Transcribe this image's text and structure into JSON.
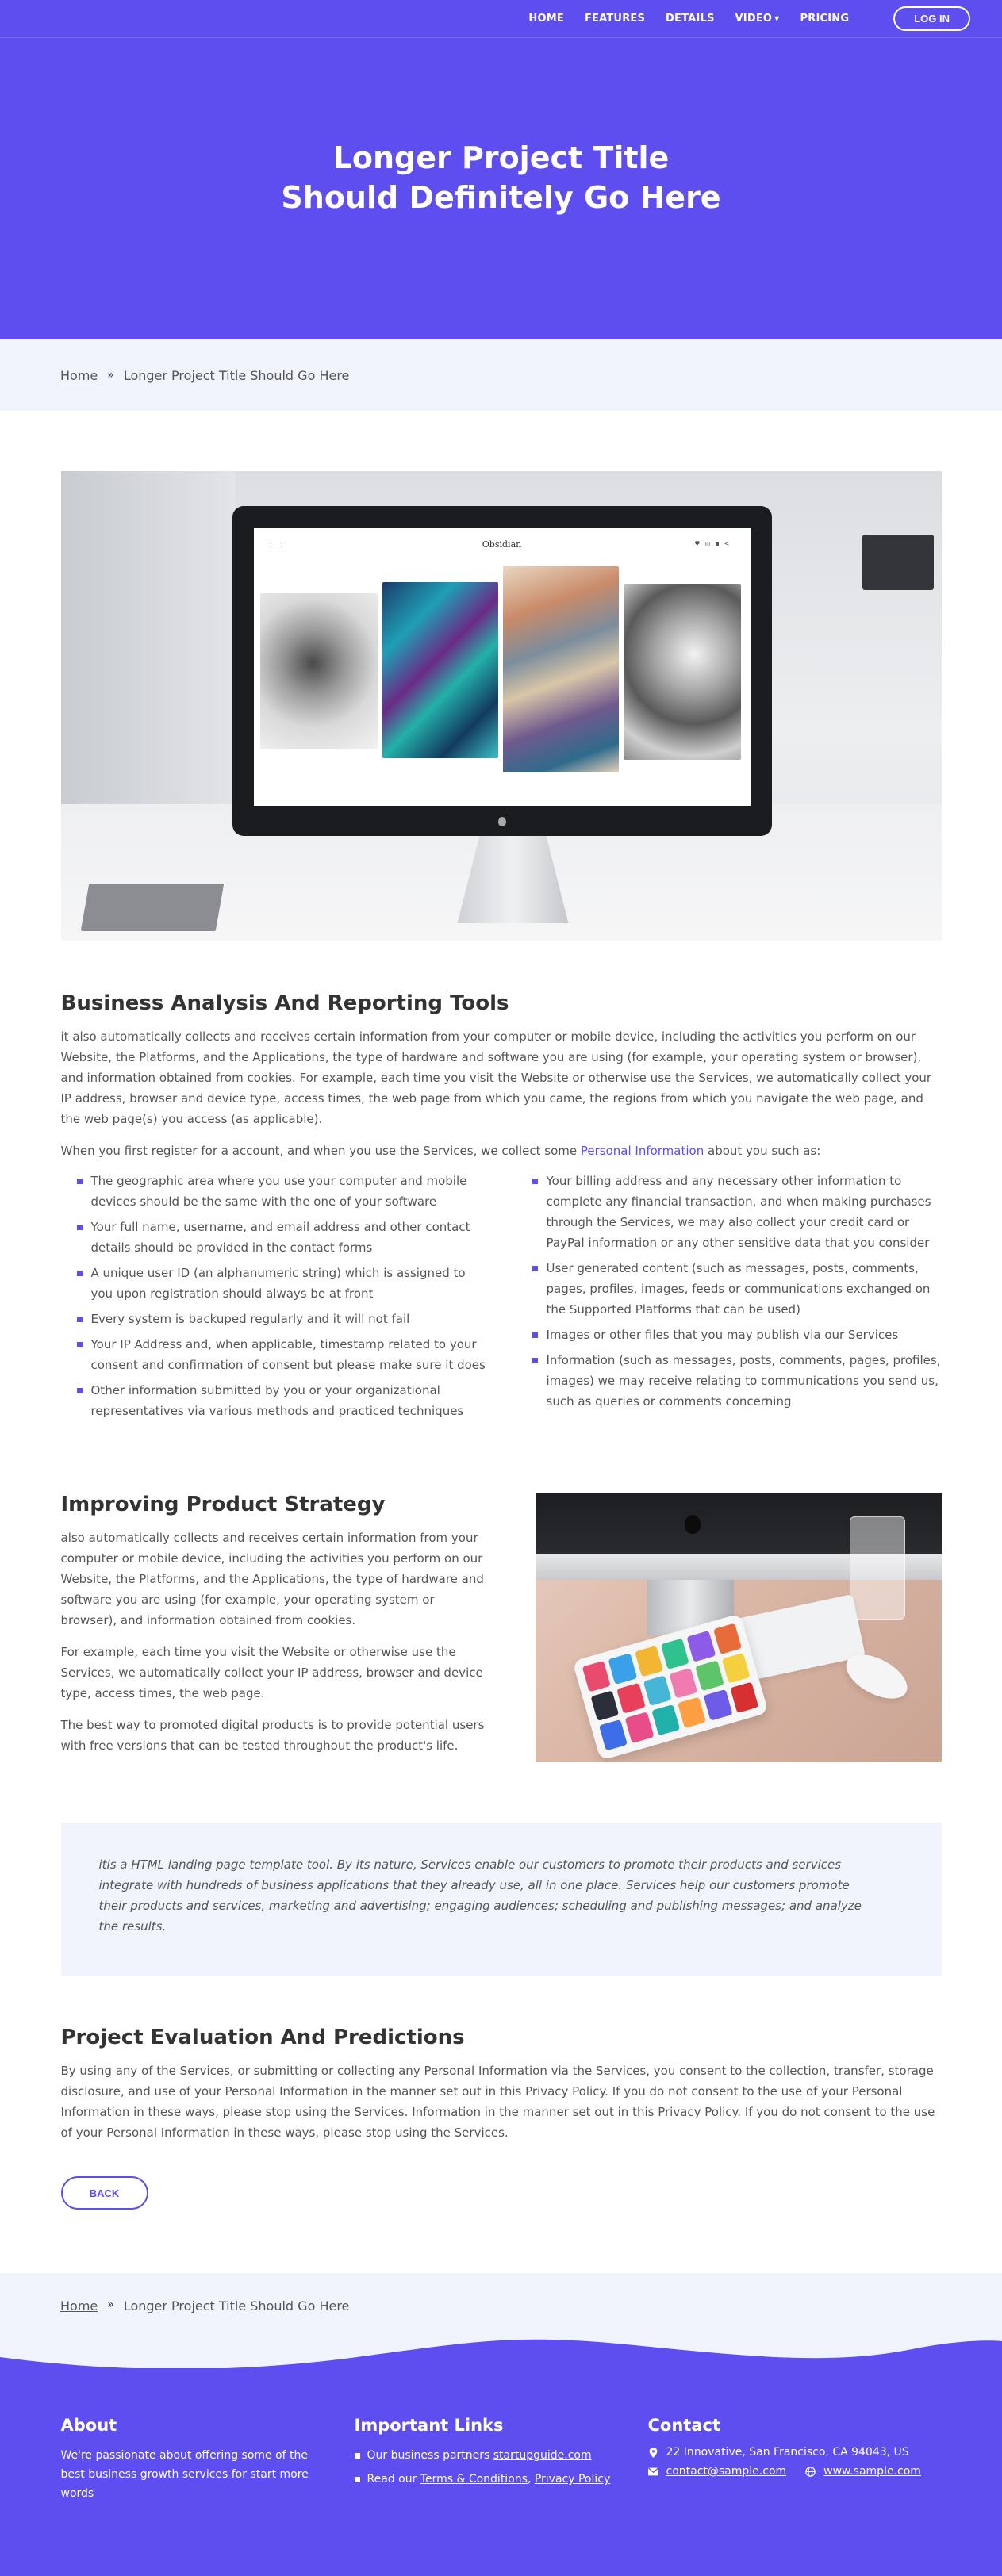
{
  "nav": {
    "links": [
      "HOME",
      "FEATURES",
      "DETAILS",
      "VIDEO",
      "PRICING"
    ],
    "login": "LOG IN"
  },
  "hero": {
    "title": "Longer Project Title Should Definitely Go Here"
  },
  "breadcrumb": {
    "home": "Home",
    "current": "Longer Project Title Should Go Here"
  },
  "main_image": {
    "screen_logo": "Obsidian",
    "icons": [
      "menu-icon",
      "twitter-icon",
      "instagram-icon",
      "linkedin-icon",
      "share-icon",
      "arrow-up-icon"
    ]
  },
  "section1": {
    "title": "Business Analysis And Reporting Tools",
    "p1": "it also automatically collects and receives certain information from your computer or mobile device, including the activities you perform on our Website, the Platforms, and the Applications, the type of hardware and software you are using (for example, your operating system or browser), and information obtained from cookies. For example, each time you visit the Website or otherwise use the Services, we automatically collect your IP address, browser and device type, access times, the web page from which you came, the regions from which you navigate the web page, and the web page(s) you access (as applicable).",
    "p2_before": "When you first register for a account, and when you use the Services, we collect some ",
    "p2_link": "Personal Information",
    "p2_after": " about you such as:",
    "list_left": [
      "The geographic area where you use your computer and mobile devices should be the same with the one of your software",
      "Your full name, username, and email address and other contact details should be provided in the contact forms",
      "A unique user ID (an alphanumeric string) which is assigned to you upon registration should always be at front",
      "Every system is backuped regularly and it will not fail",
      "Your IP Address and, when applicable, timestamp related to your consent and confirmation of consent but please make sure it does",
      "Other information submitted by you or your organizational representatives via various methods and practiced techniques"
    ],
    "list_right": [
      "Your billing address and any necessary other information to complete any financial transaction, and when making purchases through the Services, we may also collect your credit card or PayPal information or any other sensitive data that you consider",
      "User generated content (such as messages, posts, comments, pages, profiles, images, feeds or communications exchanged on the Supported Platforms that can be used)",
      "Images or other files that you may publish via our Services",
      "Information (such as messages, posts, comments, pages, profiles, images) we may receive relating to communications you send us, such as queries or comments concerning"
    ]
  },
  "section2": {
    "title": "Improving Product Strategy",
    "p1": "also automatically collects and receives certain information from your computer or mobile device, including the activities you perform on our Website, the Platforms, and the Applications, the type of hardware and software you are using (for example, your operating system or browser), and information obtained from cookies.",
    "p2": "For example, each time you visit the Website or otherwise use the Services, we automatically collect your IP address, browser and device type, access times, the web page.",
    "p3": "The best way to promoted digital products is to provide potential users with free versions that can be tested throughout the product's life."
  },
  "quote": "itis a HTML landing page template tool. By its nature, Services enable our customers to promote their products and services integrate with hundreds of business applications that they already use, all in one place. Services help our customers promote their products and services, marketing and advertising; engaging audiences; scheduling and publishing messages; and analyze the results.",
  "section3": {
    "title": "Project Evaluation And Predictions",
    "p1": "By using any of the Services, or submitting or collecting any Personal Information via the Services, you consent to the collection, transfer, storage disclosure, and use of your Personal Information in the manner set out in this Privacy Policy. If you do not consent to the use of your Personal Information in these ways, please stop using the Services. Information in the manner set out in this Privacy Policy. If you do not consent to the use of your Personal Information in these ways, please stop using the Services.",
    "back": "BACK"
  },
  "footer": {
    "about_title": "About",
    "about_text": "We're passionate about offering some of the best business growth services for start more words",
    "links_title": "Important Links",
    "link1_before": "Our business partners ",
    "link1_anchor": "startupguide.com",
    "link2_before": "Read our ",
    "link2_anchor1": "Terms & Conditions",
    "link2_sep": ", ",
    "link2_anchor2": "Privacy Policy",
    "contact_title": "Contact",
    "address": "22 Innovative, San Francisco, CA 94043, US",
    "email": "contact@sample.com",
    "website": "www.sample.com"
  },
  "colors": {
    "accent": "#5e4ef0",
    "band": "#f1f4fc",
    "heading": "#333333",
    "text": "#555555"
  }
}
